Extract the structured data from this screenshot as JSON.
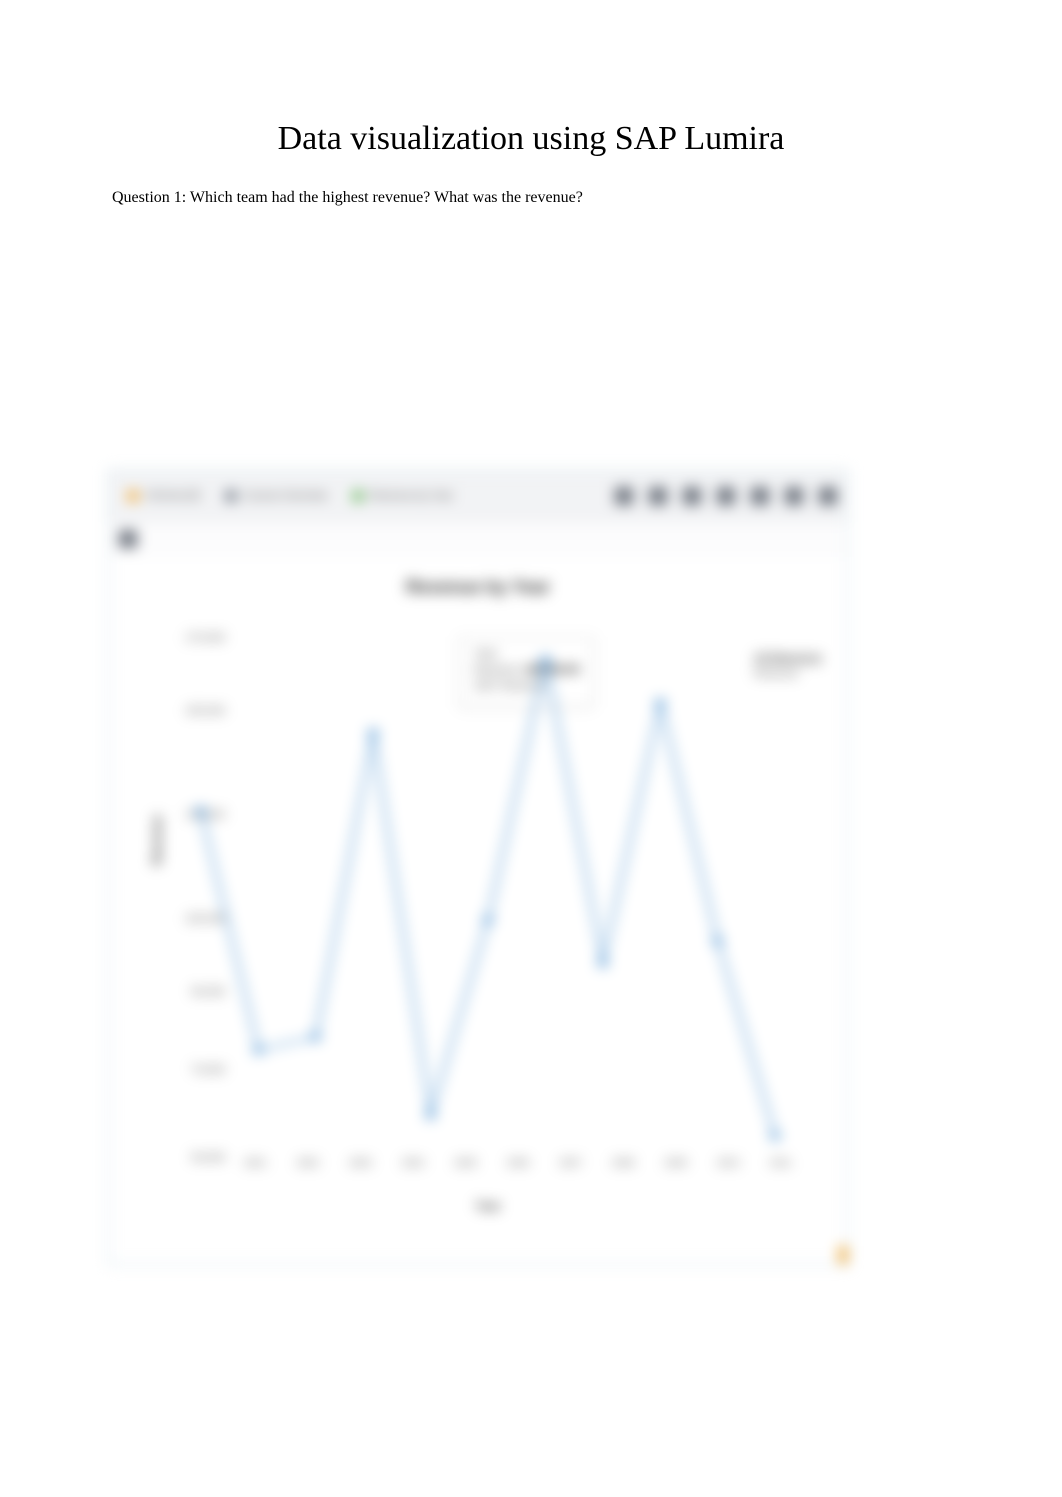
{
  "page": {
    "title": "Data visualization using SAP Lumira",
    "question": "Question 1: Which team had the highest revenue? What was the revenue?"
  },
  "toolbar": {
    "section1_label": "VISUALIZE",
    "section2_label": "Course Overview",
    "section3_label": "Revenue by Year"
  },
  "chart_data": {
    "type": "line",
    "title": "Revenue by Year",
    "xlabel": "Year",
    "ylabel": "Revenue",
    "ylim": [
      0,
      170000
    ],
    "categories": [
      "2001",
      "2002",
      "2003",
      "2004",
      "2005",
      "2006",
      "2007",
      "2008",
      "2009",
      "2010",
      "2011"
    ],
    "series": [
      {
        "name": "Revenue",
        "values": [
          130000,
          75000,
          78000,
          148000,
          60000,
          105000,
          165000,
          95000,
          155000,
          100000,
          55000
        ]
      }
    ],
    "y_ticks": [
      "170,000",
      "155,000",
      "130,000",
      "105,000",
      "90,000",
      "70,000",
      "50,000"
    ]
  },
  "tooltip": {
    "row1_label": "Year:",
    "row1_value": "",
    "row2_label": "Revenue:",
    "row2_value": "165,000.00",
    "row3_a": "2007",
    "row3_b": "Revenue"
  },
  "legend": {
    "title": "All Measures",
    "item": "Revenue"
  }
}
